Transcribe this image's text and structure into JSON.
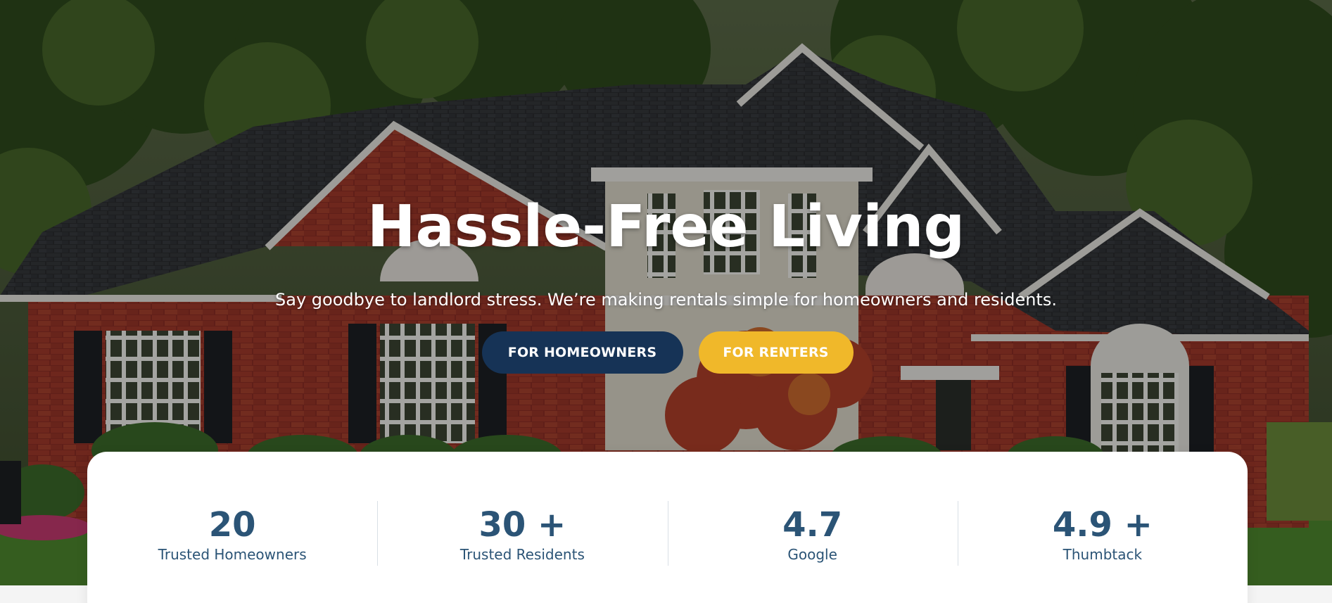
{
  "hero": {
    "title": "Hassle-Free Living",
    "subtitle": "Say goodbye to landlord stress. We’re making rentals simple for homeowners and residents.",
    "background_image": "brick-house-photo"
  },
  "buttons": {
    "homeowners_label": "FOR HOMEOWNERS",
    "renters_label": "FOR RENTERS"
  },
  "colors": {
    "navy": "#163356",
    "gold": "#f0b82a",
    "stat_text": "#2b5476",
    "white": "#ffffff"
  },
  "stats": [
    {
      "value": "20",
      "label": "Trusted Homeowners"
    },
    {
      "value": "30 +",
      "label": "Trusted Residents"
    },
    {
      "value": "4.7",
      "label": "Google"
    },
    {
      "value": "4.9 +",
      "label": "Thumbtack"
    }
  ]
}
